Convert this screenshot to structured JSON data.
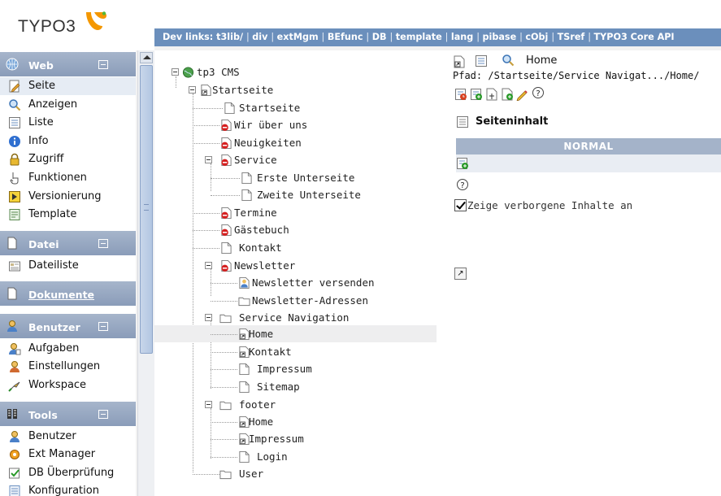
{
  "header": {
    "logo_text": "TYPO3",
    "devlinks": [
      "Dev links: t3lib/",
      "div",
      "extMgm",
      "BEfunc",
      "DB",
      "template",
      "lang",
      "pibase",
      "cObj",
      "TSref",
      "TYPO3 Core API"
    ]
  },
  "menu": {
    "modules": [
      {
        "title": "Web",
        "items": [
          "Seite",
          "Anzeigen",
          "Liste",
          "Info",
          "Zugriff",
          "Funktionen",
          "Versionierung",
          "Template"
        ]
      },
      {
        "title": "Datei",
        "items": [
          "Dateiliste"
        ]
      },
      {
        "title": "Dokumente",
        "items": []
      },
      {
        "title": "Benutzer",
        "items": [
          "Aufgaben",
          "Einstellungen",
          "Workspace"
        ]
      },
      {
        "title": "Tools",
        "items": [
          "Benutzer",
          "Ext Manager",
          "DB Überprüfung",
          "Konfiguration"
        ]
      }
    ]
  },
  "tree": {
    "root": "tp3 CMS",
    "nodes": [
      "Startseite",
      "Startseite",
      "Wir über uns",
      "Neuigkeiten",
      "Service",
      "Erste Unterseite",
      "Zweite Unterseite",
      "Termine",
      "Gästebuch",
      "Kontakt",
      "Newsletter",
      "Newsletter versenden",
      "Newsletter-Adressen",
      "Service Navigation",
      "Home",
      "Kontakt",
      "Impressum",
      "Sitemap",
      "footer",
      "Home",
      "Impressum",
      "Login",
      "User"
    ]
  },
  "content": {
    "page_title": "Home",
    "path": "Pfad: /Startseite/Service Navigat.../Home/",
    "section_title": "Seiteninhalt",
    "column_header": "NORMAL",
    "hidden_label": "Zeige verborgene Inhalte an",
    "hidden_checked": true,
    "help_icon_text": "?",
    "jump_icon_text": "↗"
  },
  "colors": {
    "devbar": "#6b8fbc",
    "module_header": "#8a9cb9",
    "column_header": "#a4b3c9",
    "highlight_row": "#eeeeef",
    "logo_orange": "#f49700"
  }
}
